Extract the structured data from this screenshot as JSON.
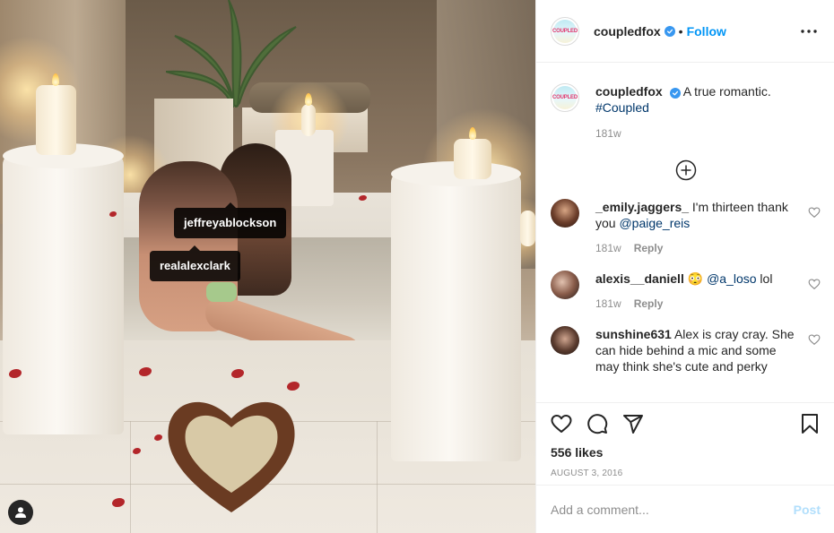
{
  "post": {
    "username": "coupledfox",
    "follow_label": "Follow",
    "separator": "•",
    "avatar_text": "COUPLED"
  },
  "photo": {
    "tags": [
      "jeffreyablockson",
      "realalexclark"
    ]
  },
  "caption": {
    "username": "coupledfox",
    "text": "A true romantic.",
    "hashtag": "#Coupled",
    "age": "181w"
  },
  "comments": [
    {
      "username": "_emily.jaggers_",
      "text": "I'm thirteen thank you",
      "mention": "@paige_reis",
      "age": "181w",
      "reply_label": "Reply"
    },
    {
      "username": "alexis__daniell",
      "emoji": "😳",
      "mention": "@a_loso",
      "text": "lol",
      "age": "181w",
      "reply_label": "Reply"
    },
    {
      "username": "sunshine631",
      "text": "Alex is cray cray. She can hide behind a mic and some may think she's cute and perky"
    }
  ],
  "actions": {
    "likes": "556 likes",
    "date": "AUGUST 3, 2016"
  },
  "composer": {
    "placeholder": "Add a comment...",
    "post_label": "Post"
  },
  "colors": {
    "accent": "#0095f6",
    "verified": "#3897f0",
    "text": "#262626",
    "muted": "#8e8e8e",
    "post_disabled": "#b2dffc",
    "petal": "#b3262a"
  },
  "icons": [
    "more-icon",
    "verified-icon",
    "load-more-icon",
    "heart-icon",
    "comment-icon",
    "share-icon",
    "save-icon",
    "user-tag-icon"
  ]
}
